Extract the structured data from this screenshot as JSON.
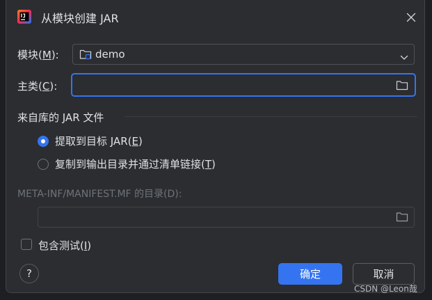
{
  "dialog": {
    "title": "从模块创建 JAR",
    "icon": "intellij-idea-icon",
    "close_icon": "close-icon"
  },
  "module": {
    "label_pre": "模块(",
    "label_mnemonic": "M",
    "label_post": "):",
    "value": "demo"
  },
  "main_class": {
    "label_pre": "主类(",
    "label_mnemonic": "C",
    "label_post": "):",
    "value": ""
  },
  "jar_section": {
    "title": "来自库的 JAR 文件",
    "option_extract": {
      "label_pre": "提取到目标 JAR(",
      "label_mnemonic": "E",
      "label_post": ")",
      "selected": true
    },
    "option_copy": {
      "label_pre": "复制到输出目录并通过清单链接(",
      "label_mnemonic": "T",
      "label_post": ")",
      "selected": false
    }
  },
  "manifest": {
    "label": "META-INF/MANIFEST.MF 的目录(D):",
    "value": ""
  },
  "include_tests": {
    "label_pre": "包含测试(",
    "label_mnemonic": "I",
    "label_post": ")",
    "checked": false
  },
  "buttons": {
    "help": "?",
    "ok": "确定",
    "cancel": "取消"
  },
  "watermark": "CSDN @Leon哉",
  "colors": {
    "accent": "#3574f0",
    "background": "#2b2d30",
    "text": "#dfe1e5",
    "disabled_text": "#6f737a"
  }
}
